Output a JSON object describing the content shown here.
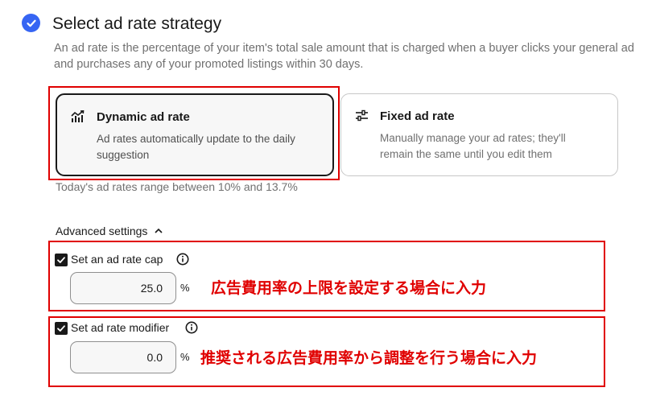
{
  "header": {
    "title": "Select ad rate strategy",
    "description": "An ad rate is the percentage of your item's total sale amount that is charged when a buyer clicks your general ad and purchases any of your promoted listings within 30 days."
  },
  "strategies": [
    {
      "title": "Dynamic ad rate",
      "description": "Ad rates automatically update to the daily suggestion",
      "icon": "trend-up-icon",
      "selected": true
    },
    {
      "title": "Fixed ad rate",
      "description": "Manually manage your ad rates; they'll remain the same until you edit them",
      "icon": "sliders-icon",
      "selected": false
    }
  ],
  "range_note": "Today's ad rates range between 10% and 13.7%",
  "advanced": {
    "label": "Advanced settings",
    "cap": {
      "label": "Set an ad rate cap",
      "checked": true,
      "value": "25.0",
      "unit": "%",
      "note": "広告費用率の上限を設定する場合に入力"
    },
    "modifier": {
      "label": "Set ad rate modifier",
      "checked": true,
      "value": "0.0",
      "unit": "%",
      "note": "推奨される広告費用率から調整を行う場合に入力"
    }
  },
  "colors": {
    "accent": "#3665f3",
    "annotation_red": "#e00000",
    "text": "#191919",
    "muted": "#707070"
  }
}
